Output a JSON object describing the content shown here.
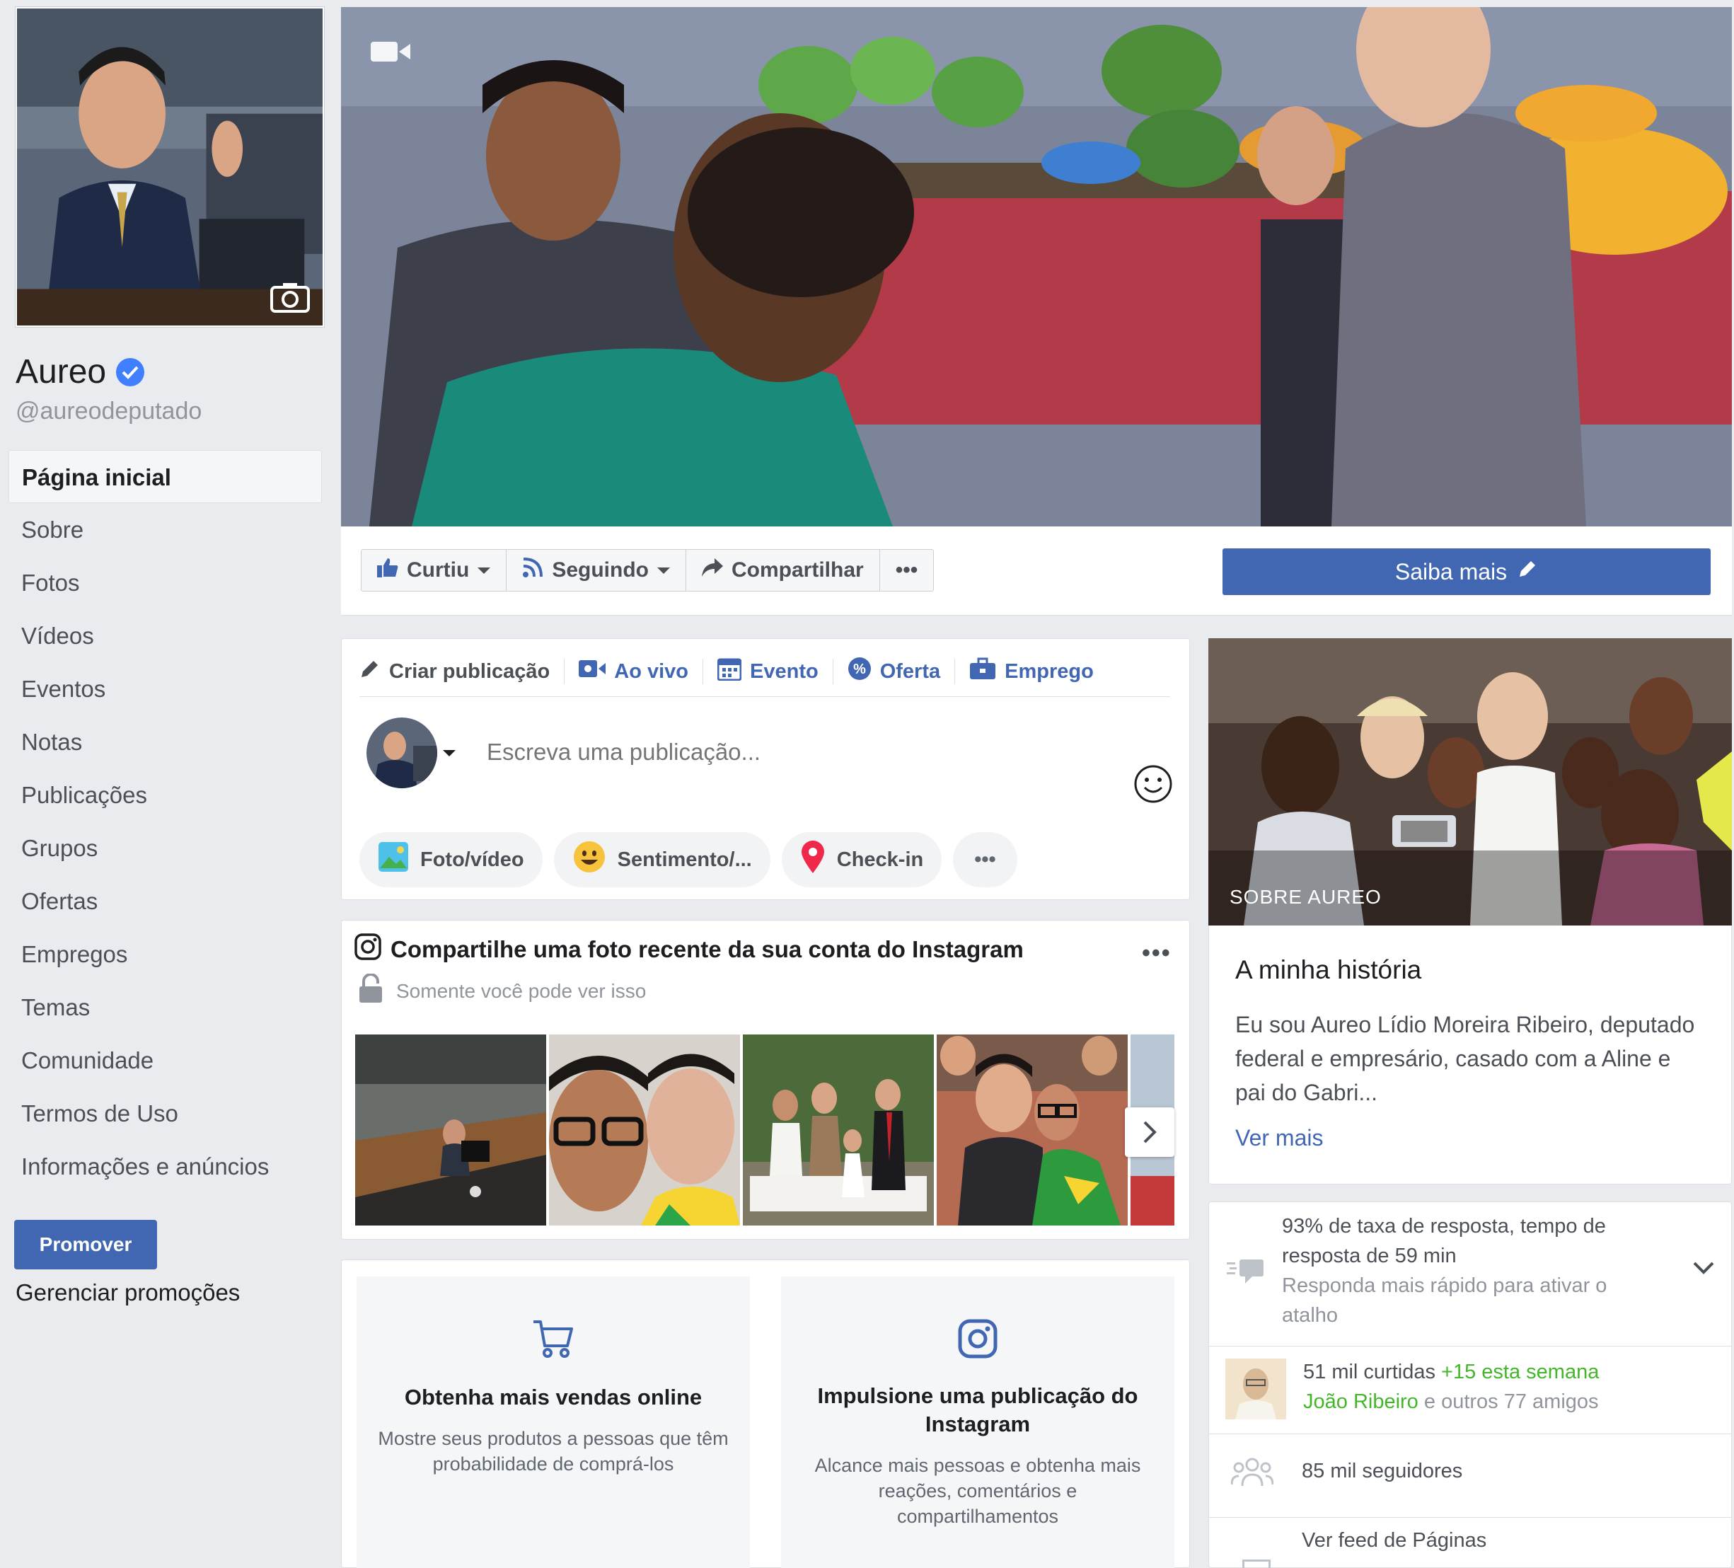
{
  "page": {
    "name": "Aureo",
    "username": "@aureodeputado"
  },
  "nav": [
    "Página inicial",
    "Sobre",
    "Fotos",
    "Vídeos",
    "Eventos",
    "Notas",
    "Publicações",
    "Grupos",
    "Ofertas",
    "Empregos",
    "Temas",
    "Comunidade",
    "Termos de Uso",
    "Informações e anúncios"
  ],
  "promote": "Promover",
  "manage_promotions": "Gerenciar promoções",
  "actions": {
    "liked": "Curtiu",
    "following": "Seguindo",
    "share": "Compartilhar",
    "more": "•••",
    "learn_more": "Saiba mais"
  },
  "composer": {
    "tabs": [
      "Criar publicação",
      "Ao vivo",
      "Evento",
      "Oferta",
      "Emprego"
    ],
    "placeholder": "Escreva uma publicação...",
    "buttons": [
      "Foto/vídeo",
      "Sentimento/...",
      "Check-in",
      "•••"
    ]
  },
  "instagram": {
    "title": "Compartilhe uma foto recente da sua conta do Instagram",
    "privacy": "Somente você pode ver isso",
    "more": "•••"
  },
  "promos": [
    {
      "title": "Obtenha mais vendas online",
      "text": "Mostre seus produtos a pessoas que têm probabilidade de comprá-los"
    },
    {
      "title": "Impulsione uma publicação do Instagram",
      "text": "Alcance mais pessoas e obtenha mais reações, comentários e compartilhamentos"
    }
  ],
  "about": {
    "label": "SOBRE AUREO",
    "heading": "A minha história",
    "story": "Eu sou Aureo Lídio Moreira Ribeiro, deputado federal e empresário, casado com a Aline e pai do Gabri...",
    "more": "Ver mais"
  },
  "stats": {
    "response": "93% de taxa de resposta, tempo de resposta de 59 min",
    "response_hint": "Responda mais rápido para ativar o atalho",
    "likes": "51 mil curtidas",
    "likes_week": "+15 esta semana",
    "friend_name": "João Ribeiro",
    "friends_suffix": "e outros 77 amigos",
    "followers": "85 mil seguidores",
    "feed": "Ver feed de Páginas"
  },
  "colors": {
    "brand": "#4267b2",
    "verified": "#4080ff",
    "positive": "#42b72a",
    "background": "#e9ebee"
  }
}
